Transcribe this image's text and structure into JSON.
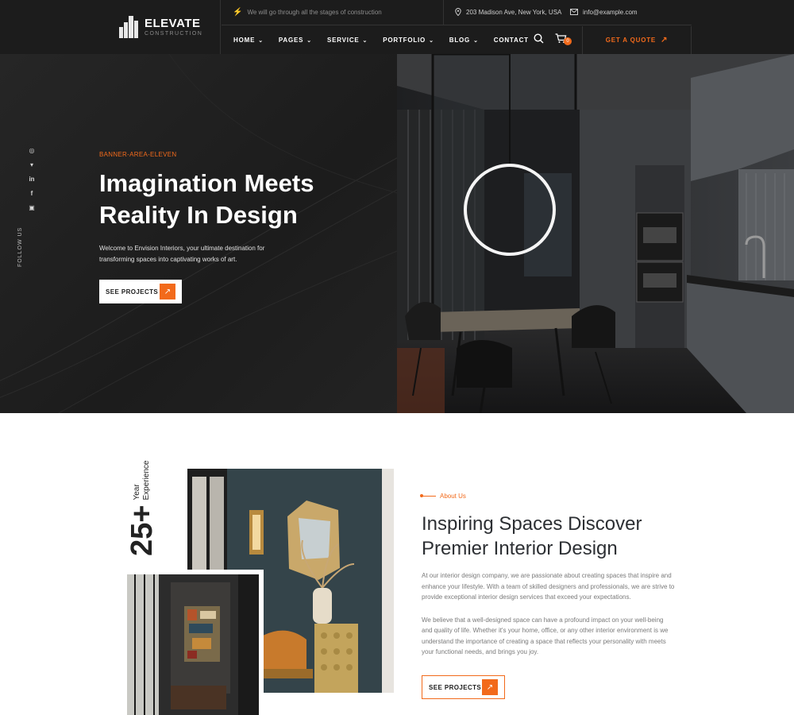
{
  "brand": {
    "name": "ELEVATE",
    "sub": "CONSTRUCTION"
  },
  "topbar": {
    "tagline": "We will go through all the stages of construction",
    "address": "203 Madison Ave, New York, USA",
    "email": "info@example.com"
  },
  "nav": {
    "items": [
      {
        "label": "HOME",
        "dropdown": true
      },
      {
        "label": "PAGES",
        "dropdown": true
      },
      {
        "label": "SERVICE",
        "dropdown": true
      },
      {
        "label": "PORTFOLIO",
        "dropdown": true
      },
      {
        "label": "BLOG",
        "dropdown": true
      },
      {
        "label": "CONTACT",
        "dropdown": false
      }
    ],
    "cart_count": "0",
    "quote_label": "GET A QUOTE"
  },
  "hero": {
    "eyebrow": "BANNER-AREA-ELEVEN",
    "title": "Imagination Meets Reality In Design",
    "description": "Welcome to Envision Interiors, your ultimate destination for transforming spaces into captivating works of art.",
    "button_label": "SEE PROJECTS",
    "follow_label": "FOLLOW US",
    "social": [
      "instagram-icon",
      "twitter-icon",
      "linkedin-icon",
      "facebook-icon",
      "youtube-icon"
    ]
  },
  "about": {
    "years": "25+",
    "years_label": "Year Experience",
    "eyebrow": "About Us",
    "title": "Inspiring Spaces Discover Premier Interior Design",
    "paragraph1": "At our interior design company, we are passionate about creating spaces that inspire and enhance your lifestyle. With a team of skilled designers and professionals, we are strive to provide exceptional interior design services that exceed your expectations.",
    "paragraph2": "We believe that a well-designed space can have a profound impact on your well-being and quality of life. Whether it's your home, office, or any other interior environment is we understand the importance of creating a space that reflects your personality with meets your functional needs, and brings you joy.",
    "button_label": "SEE PROJECTS"
  },
  "colors": {
    "accent": "#f26a1b",
    "dark": "#1c1c1c",
    "hero_bg": "#1f1f1f"
  }
}
